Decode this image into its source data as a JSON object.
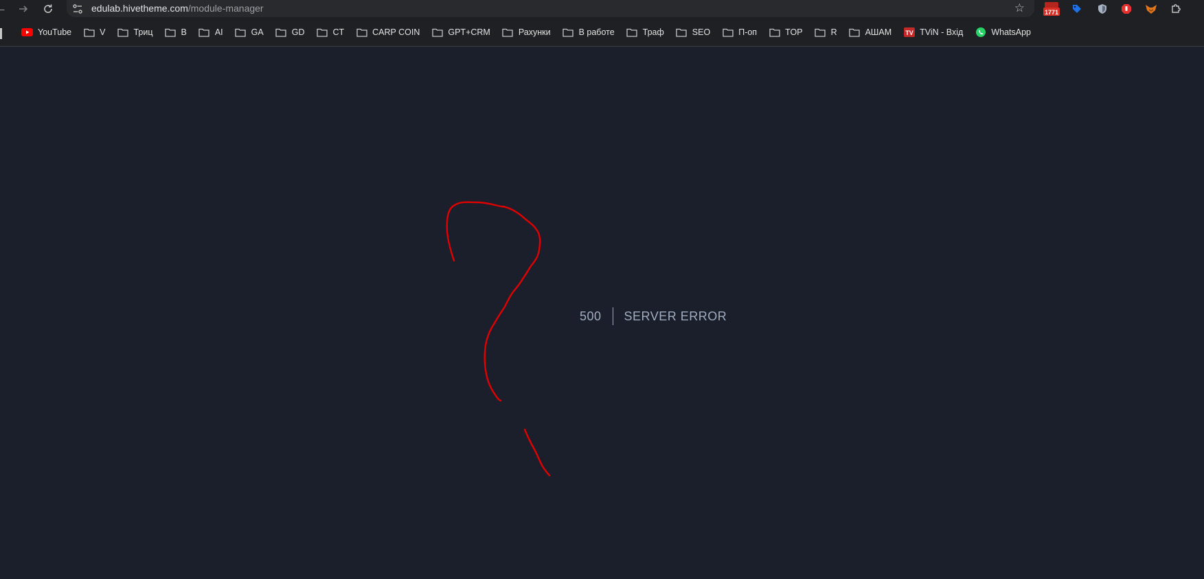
{
  "browser": {
    "url_host": "edulab.hivetheme.com",
    "url_path": "/module-manager",
    "nav": {
      "back_icon": "back-arrow-icon",
      "forward_icon": "forward-arrow-icon",
      "reload_icon": "reload-icon"
    },
    "extensions": [
      {
        "name": "mail-counter-extension",
        "badge": "1771",
        "color": "#d93025"
      },
      {
        "name": "tag-extension",
        "color": "#1a73e8"
      },
      {
        "name": "shield-extension",
        "color": "#a8b2c1"
      },
      {
        "name": "stop-hand-extension",
        "color": "#e8312f"
      },
      {
        "name": "fox-wallet-extension",
        "color": "#e2761b"
      },
      {
        "name": "puzzle-extensions-icon",
        "color": "#c7c7c7"
      }
    ]
  },
  "bookmarks": [
    {
      "label": "YouTube",
      "icon": "youtube-icon"
    },
    {
      "label": "V",
      "icon": "folder-icon"
    },
    {
      "label": "Триц",
      "icon": "folder-icon"
    },
    {
      "label": "B",
      "icon": "folder-icon"
    },
    {
      "label": "AI",
      "icon": "folder-icon"
    },
    {
      "label": "GA",
      "icon": "folder-icon"
    },
    {
      "label": "GD",
      "icon": "folder-icon"
    },
    {
      "label": "CT",
      "icon": "folder-icon"
    },
    {
      "label": "CARP COIN",
      "icon": "folder-icon"
    },
    {
      "label": "GPT+CRM",
      "icon": "folder-icon"
    },
    {
      "label": "Рахунки",
      "icon": "folder-icon"
    },
    {
      "label": "В работе",
      "icon": "folder-icon"
    },
    {
      "label": "Траф",
      "icon": "folder-icon"
    },
    {
      "label": "SEO",
      "icon": "folder-icon"
    },
    {
      "label": "П-оп",
      "icon": "folder-icon"
    },
    {
      "label": "TOP",
      "icon": "folder-icon"
    },
    {
      "label": "R",
      "icon": "folder-icon"
    },
    {
      "label": "АШАМ",
      "icon": "folder-icon"
    },
    {
      "label": "TViN - Вхід",
      "icon": "tvin-icon"
    },
    {
      "label": "WhatsApp",
      "icon": "whatsapp-icon"
    }
  ],
  "error": {
    "code": "500",
    "message": "SERVER ERROR"
  },
  "colors": {
    "page_background": "#1b1f2b",
    "error_text": "#a0aec0",
    "annotation": "#e00000"
  }
}
